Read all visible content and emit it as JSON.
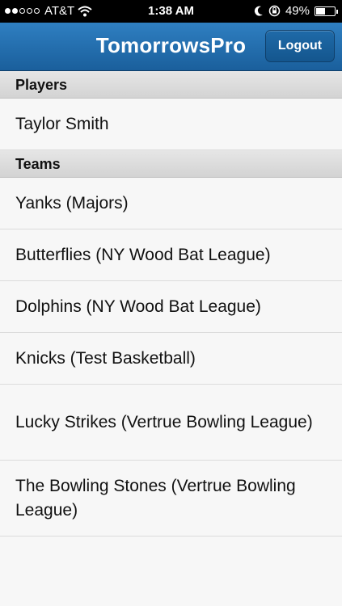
{
  "status_bar": {
    "signal_filled": 2,
    "signal_total": 5,
    "carrier": "AT&T",
    "time": "1:38 AM",
    "battery_percent": "49%",
    "battery_level": 0.49,
    "icons": [
      "wifi-icon",
      "moon-icon",
      "rotation-lock-icon",
      "battery-icon"
    ]
  },
  "nav": {
    "title": "TomorrowsPro",
    "logout_label": "Logout"
  },
  "sections": {
    "players": {
      "header": "Players",
      "items": [
        "Taylor Smith"
      ]
    },
    "teams": {
      "header": "Teams",
      "items": [
        "Yanks (Majors)",
        "Butterflies (NY Wood Bat League)",
        "Dolphins (NY Wood Bat League)",
        "Knicks (Test Basketball)",
        "Lucky Strikes (Vertrue Bowling League)",
        "The Bowling Stones (Vertrue Bowling League)"
      ]
    }
  },
  "colors": {
    "nav_blue": "#1a5f9c",
    "background": "#f7f7f7"
  }
}
